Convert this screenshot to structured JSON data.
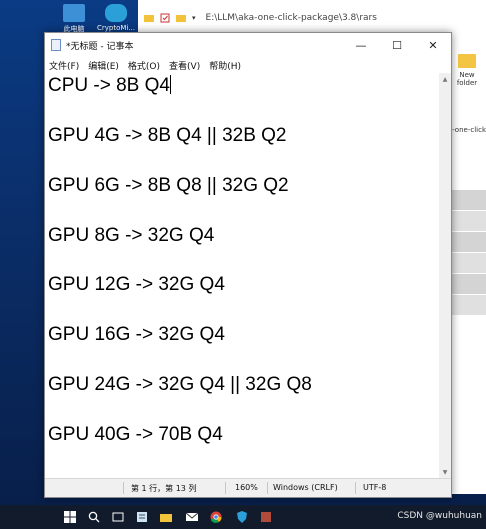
{
  "desktop": {
    "icons": [
      {
        "label": "此电脑"
      },
      {
        "label": "CryptoMi..."
      }
    ]
  },
  "explorer": {
    "path": "E:\\LLM\\aka-one-click-package\\3.8\\rars",
    "new_folder_label": "New folder",
    "aka_label": "aka-one-click"
  },
  "notepad": {
    "title": "*无标题 - 记事本",
    "menu": [
      "文件(F)",
      "编辑(E)",
      "格式(O)",
      "查看(V)",
      "帮助(H)"
    ],
    "lines": [
      "CPU -> 8B Q4",
      "GPU 4G -> 8B Q4 || 32B Q2",
      "GPU 6G -> 8B Q8 || 32G Q2",
      "GPU 8G -> 32G Q4",
      "GPU 12G -> 32G Q4",
      "GPU 16G -> 32G Q4",
      "GPU 24G -> 32G Q4 || 32G Q8",
      "GPU 40G -> 70B Q4"
    ],
    "status": {
      "position": "第 1 行，第 13 列",
      "zoom": "160%",
      "line_ending": "Windows (CRLF)",
      "encoding": "UTF-8"
    }
  },
  "watermark": "CSDN @wuhuhuan"
}
